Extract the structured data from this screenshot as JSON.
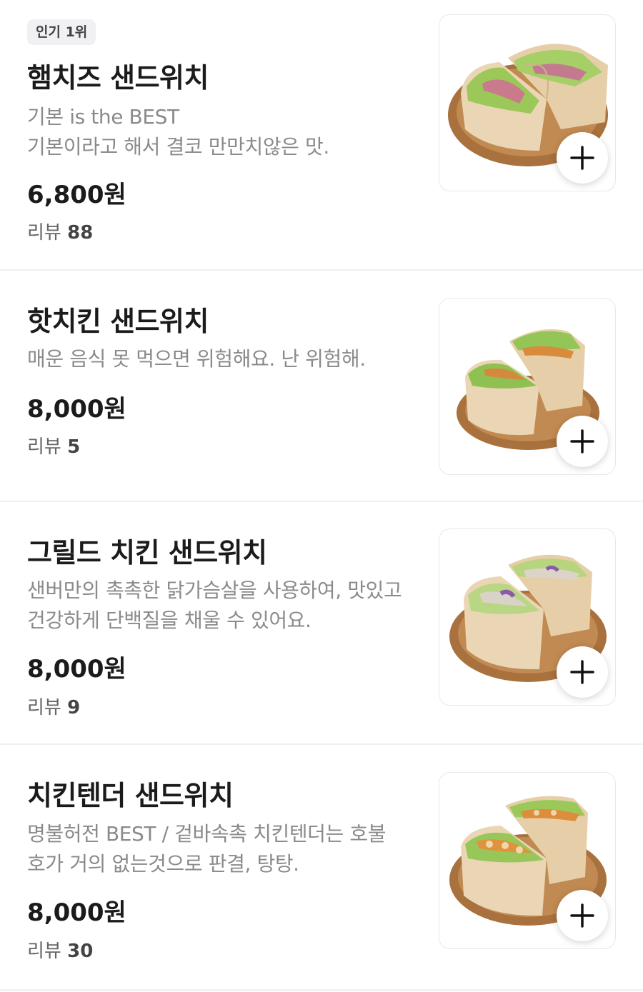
{
  "items": [
    {
      "badge": "인기 1위",
      "name": "햄치즈 샌드위치",
      "desc": [
        "기본 is the BEST",
        "기본이라고 해서 결코 만만치않은 맛."
      ],
      "price": "6,800원",
      "review_label": "리뷰",
      "review_count": "88",
      "image_icon": "ham-cheese-sandwich-image",
      "add_icon": "plus-icon"
    },
    {
      "name": "핫치킨 샌드위치",
      "desc": [
        "매운 음식 못 먹으면 위험해요. 난 위험해."
      ],
      "price": "8,000원",
      "review_label": "리뷰",
      "review_count": "5",
      "image_icon": "hot-chicken-sandwich-image",
      "add_icon": "plus-icon"
    },
    {
      "name": "그릴드 치킨 샌드위치",
      "desc": [
        "샌버만의 촉촉한 닭가슴살을 사용하여, 맛있고",
        "건강하게 단백질을 채울 수 있어요."
      ],
      "price": "8,000원",
      "review_label": "리뷰",
      "review_count": "9",
      "image_icon": "grilled-chicken-sandwich-image",
      "add_icon": "plus-icon"
    },
    {
      "name": "치킨텐더 샌드위치",
      "desc": [
        "명불허전 BEST / 겉바속촉 치킨텐더는 호불",
        "호가 거의 없는것으로 판결, 탕탕."
      ],
      "price": "8,000원",
      "review_label": "리뷰",
      "review_count": "30",
      "image_icon": "chicken-tender-sandwich-image",
      "add_icon": "plus-icon"
    }
  ],
  "colors": {
    "text_primary": "#1b1b1b",
    "text_secondary": "#8a8a8a",
    "badge_bg": "#f1f1f3",
    "divider": "#f0f0f0",
    "plate": "#b07a44",
    "paper": "#e8d2ae",
    "lettuce": "#9cc85a"
  }
}
